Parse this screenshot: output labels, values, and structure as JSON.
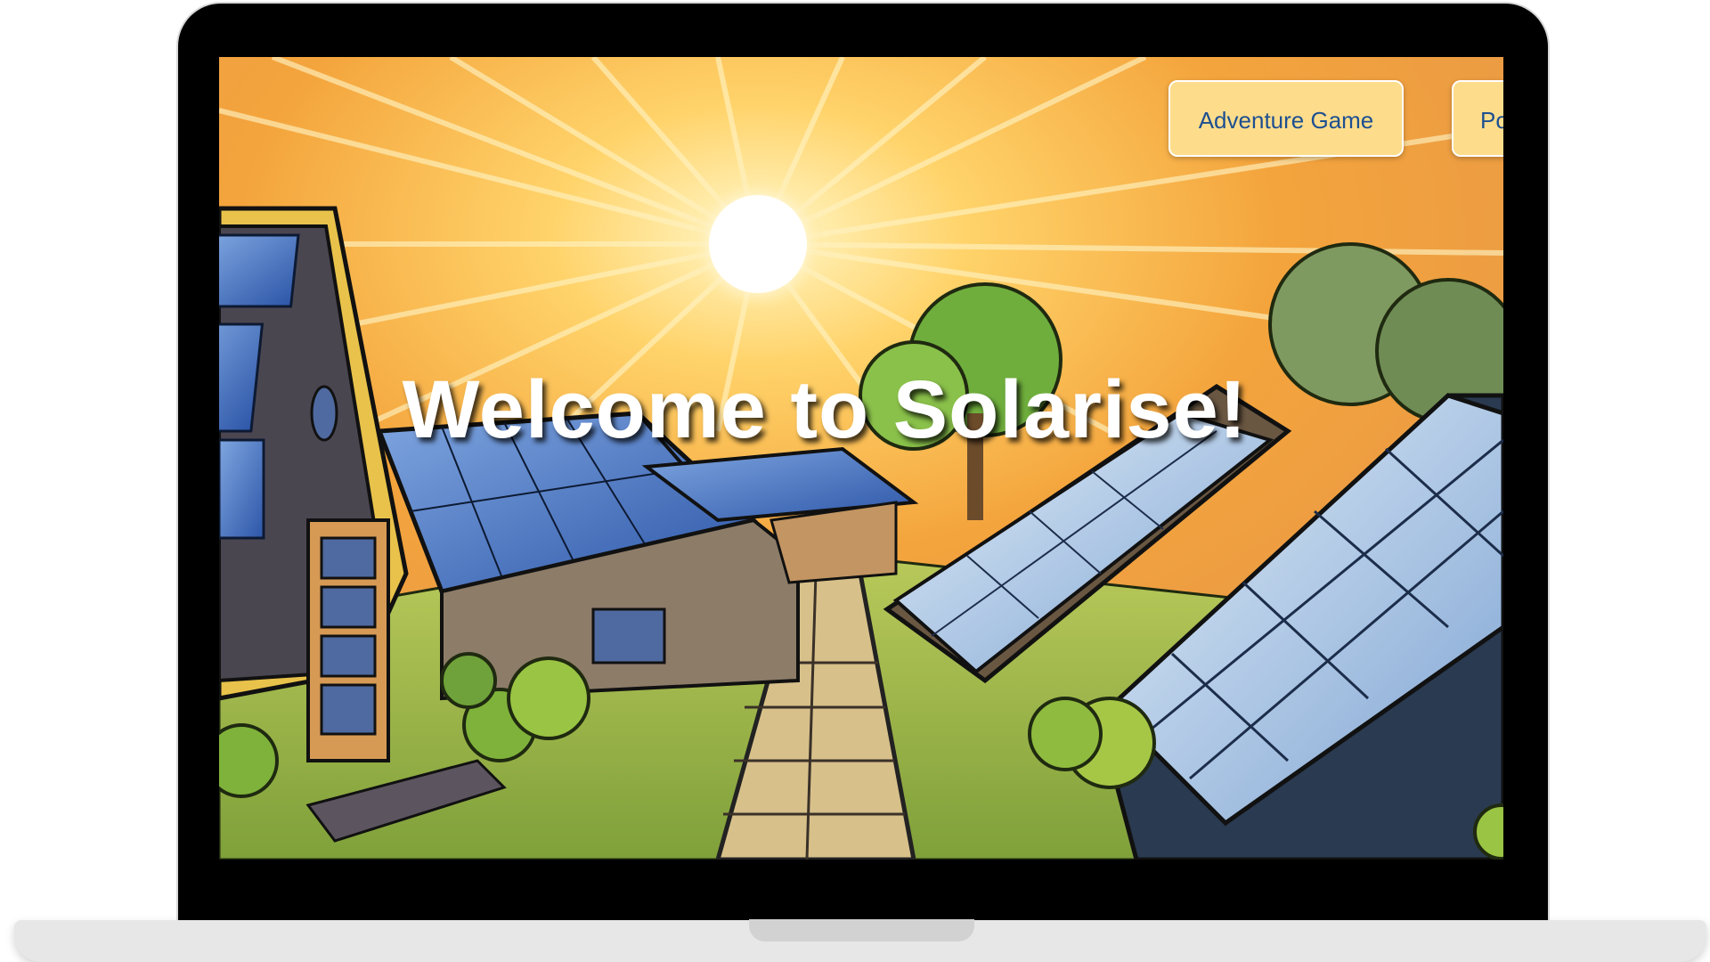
{
  "page": {
    "nav": {
      "adventure_label": "Adventure Game",
      "second_label": "Po"
    },
    "hero": {
      "title": "Welcome to Solarise!"
    },
    "background_image": "solar-village-illustration"
  },
  "colors": {
    "button_bg": "#fddd8c",
    "button_text": "#1d4f91",
    "title_text": "#ffffff"
  }
}
